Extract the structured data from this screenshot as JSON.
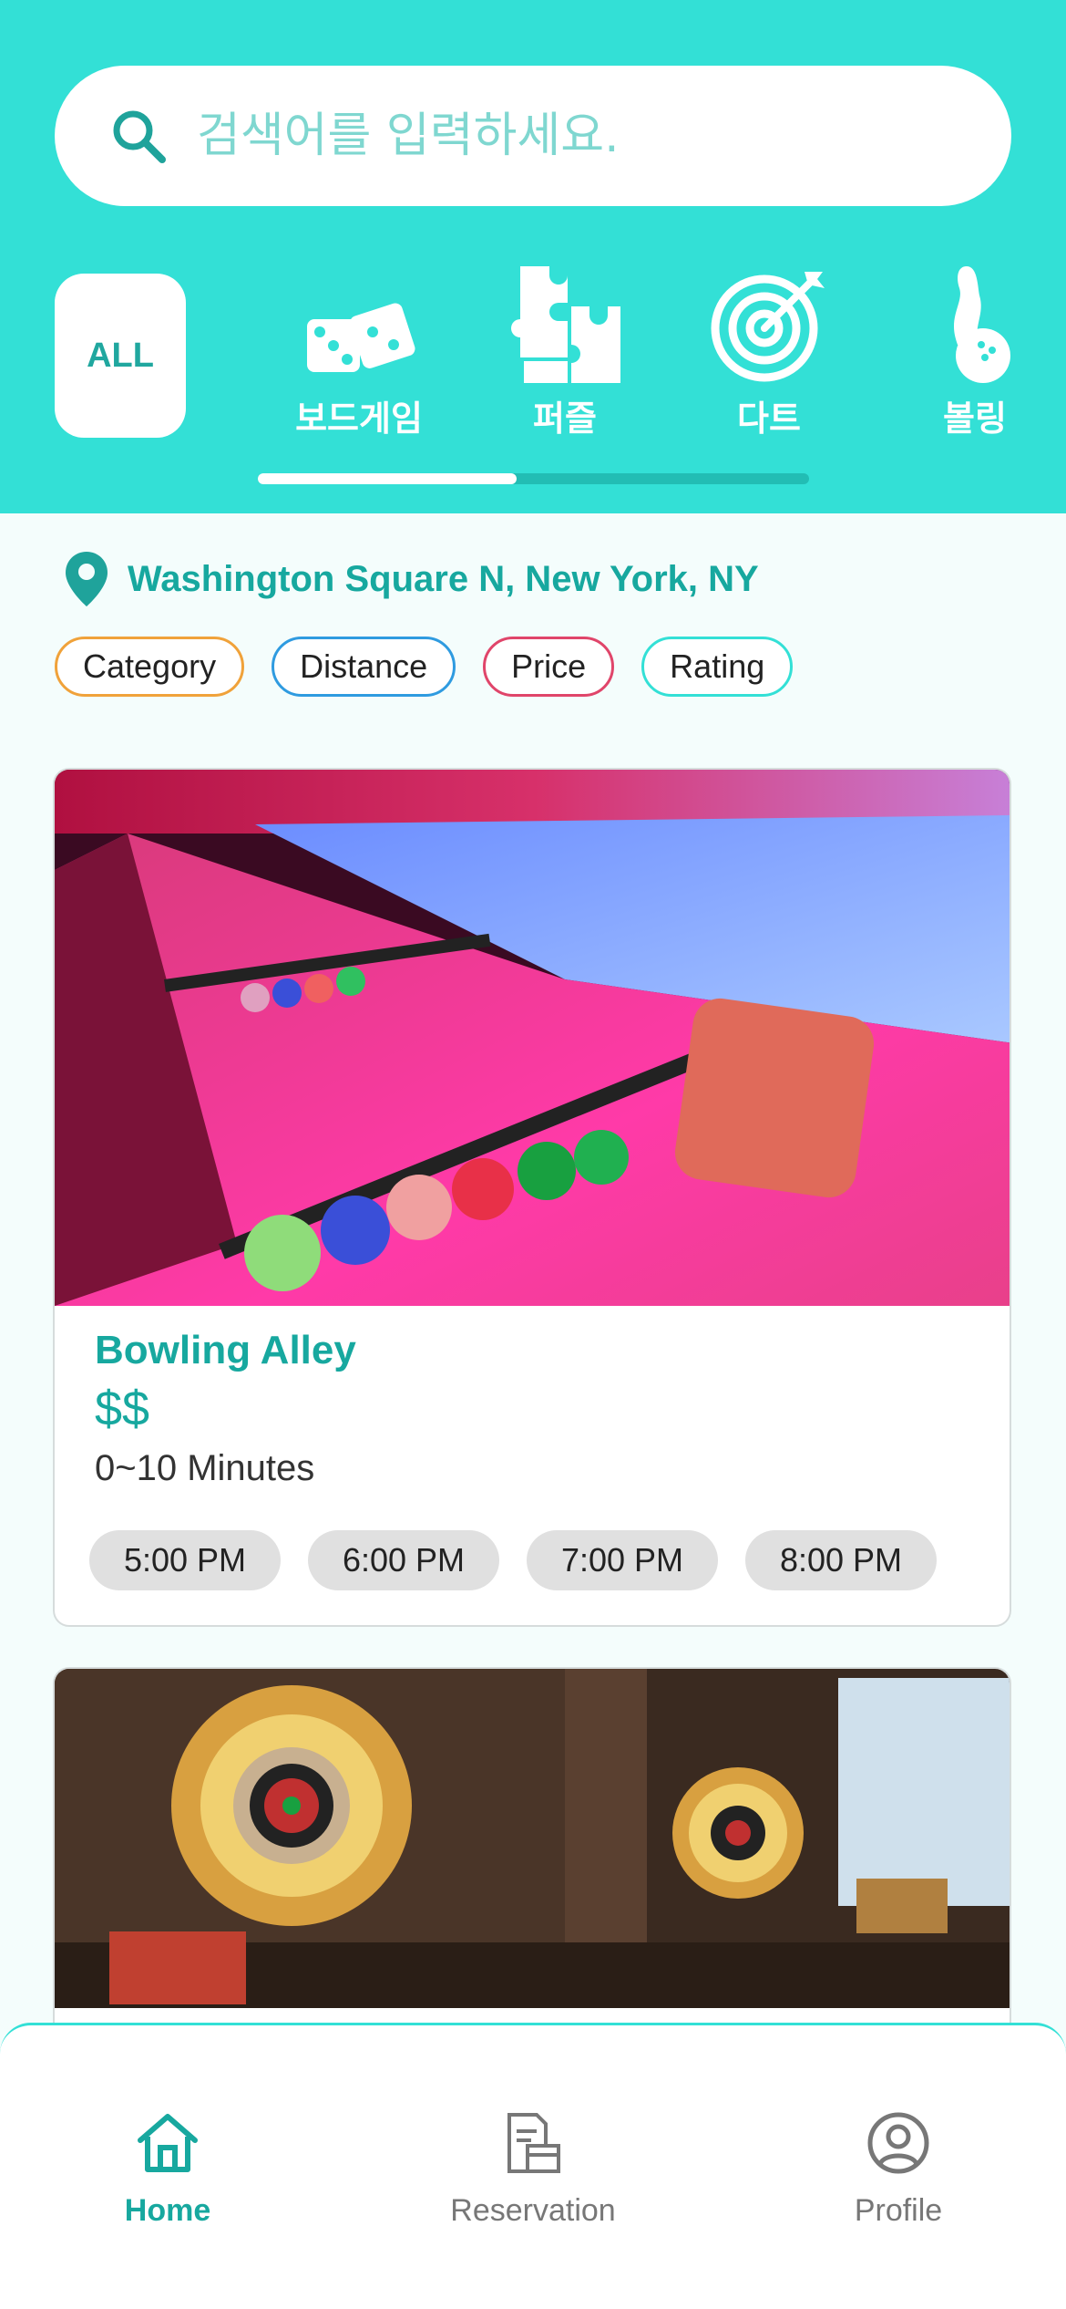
{
  "search": {
    "placeholder": "검색어를 입력하세요.",
    "icon": "search-icon"
  },
  "categories": {
    "all_label": "ALL",
    "items": [
      {
        "label": "보드게임",
        "icon": "dice-icon"
      },
      {
        "label": "퍼즐",
        "icon": "puzzle-icon"
      },
      {
        "label": "다트",
        "icon": "dart-target-icon"
      },
      {
        "label": "볼링",
        "icon": "bowling-icon"
      }
    ],
    "scroll_fraction": 0.47
  },
  "location": {
    "text": "Washington Square N, New York, NY",
    "icon": "location-pin-icon"
  },
  "filters": [
    {
      "label": "Category",
      "color": "#f0a23a"
    },
    {
      "label": "Distance",
      "color": "#2f9be0"
    },
    {
      "label": "Price",
      "color": "#e0456a"
    },
    {
      "label": "Rating",
      "color": "#33e0d6"
    }
  ],
  "venues": [
    {
      "title": "Bowling Alley",
      "price": "$$",
      "distance": "0~10 Minutes",
      "slots": [
        "5:00 PM",
        "6:00 PM",
        "7:00 PM",
        "8:00 PM"
      ]
    }
  ],
  "tabbar": {
    "items": [
      {
        "label": "Home",
        "icon": "home-icon",
        "active": true
      },
      {
        "label": "Reservation",
        "icon": "reservation-icon",
        "active": false
      },
      {
        "label": "Profile",
        "icon": "profile-icon",
        "active": false
      }
    ]
  },
  "colors": {
    "accent": "#33e0d6",
    "primary_text": "#17a89f",
    "inactive": "#777777"
  }
}
